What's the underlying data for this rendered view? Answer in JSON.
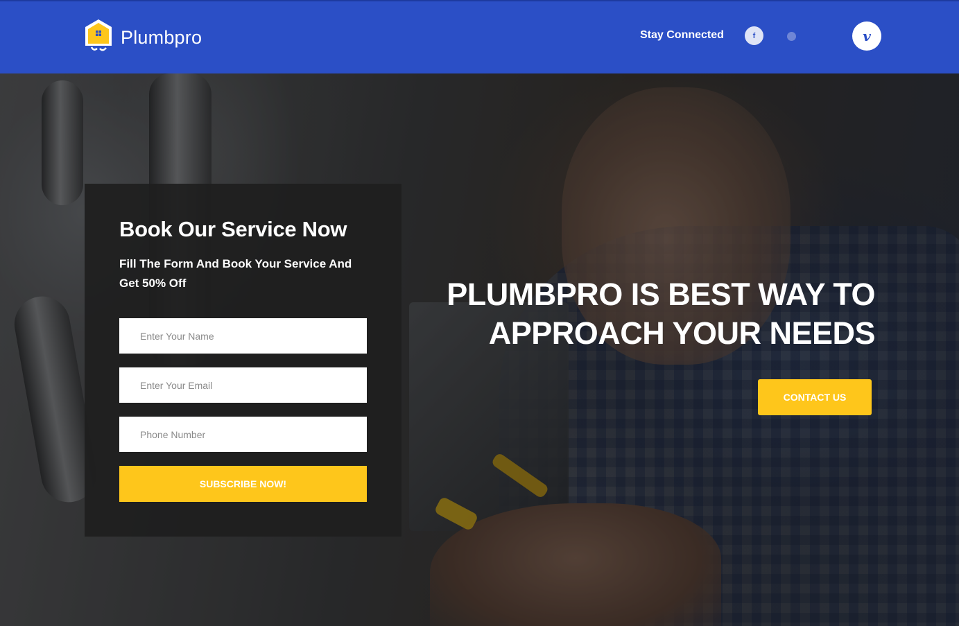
{
  "header": {
    "brand": "Plumbpro",
    "stay_connected": "Stay Connected",
    "social": {
      "facebook_glyph": "f",
      "vimeo_glyph": "v"
    },
    "colors": {
      "bar": "#2b4fc6",
      "accent": "#fec61b"
    }
  },
  "hero": {
    "headline_line1": "PLUMBPRO IS BEST WAY TO",
    "headline_line2": "APPROACH YOUR NEEDS",
    "contact_label": "CONTACT US"
  },
  "booking": {
    "title": "Book Our Service Now",
    "subtitle": "Fill The Form And Book Your Service And Get 50% Off",
    "name_placeholder": "Enter Your Name",
    "email_placeholder": "Enter Your Email",
    "phone_placeholder": "Phone Number",
    "submit_label": "SUBSCRIBE NOW!"
  }
}
